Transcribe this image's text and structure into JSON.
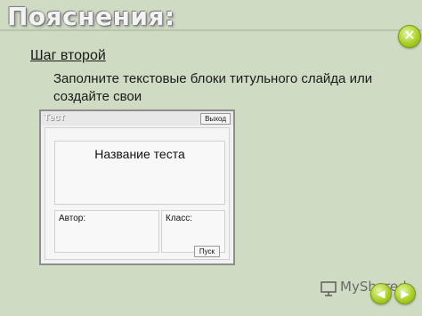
{
  "slide": {
    "title": "Пояснения:",
    "close_icon": "close-icon",
    "step_heading": "Шаг второй",
    "instruction": "Заполните текстовые блоки титульного слайда или создайте свои",
    "nav_prev_icon": "arrow-left-icon",
    "nav_next_icon": "arrow-right-icon",
    "watermark": "MyShared"
  },
  "mock_window": {
    "title": "Тест",
    "exit_label": "Выход",
    "test_name": "Название теста",
    "author_label": "Автор:",
    "class_label": "Класс:",
    "start_label": "Пуск"
  },
  "colors": {
    "background": "#cfdcc3",
    "accent_button": "#a6cc1f"
  }
}
